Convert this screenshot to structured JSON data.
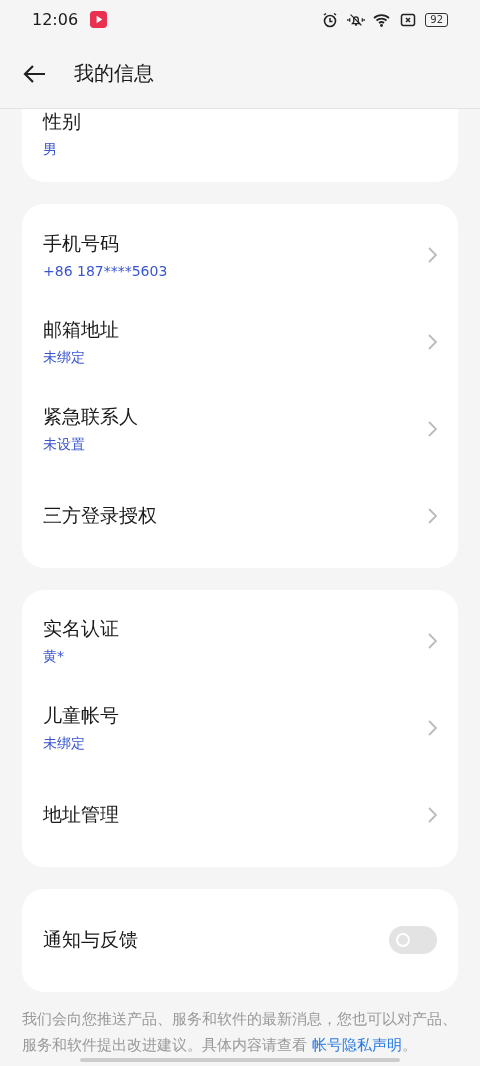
{
  "status_bar": {
    "time": "12:06",
    "battery": "92"
  },
  "header": {
    "title": "我的信息"
  },
  "groups": [
    {
      "items": [
        {
          "kind": "info",
          "label": "性别",
          "value": "男"
        }
      ]
    },
    {
      "items": [
        {
          "kind": "nav",
          "label": "手机号码",
          "value": "+86 187****5603"
        },
        {
          "kind": "nav",
          "label": "邮箱地址",
          "value": "未绑定"
        },
        {
          "kind": "nav",
          "label": "紧急联系人",
          "value": "未设置"
        },
        {
          "kind": "nav",
          "label": "三方登录授权"
        }
      ]
    },
    {
      "items": [
        {
          "kind": "nav",
          "label": "实名认证",
          "value": "黄*"
        },
        {
          "kind": "nav",
          "label": "儿童帐号",
          "value": "未绑定"
        },
        {
          "kind": "nav",
          "label": "地址管理"
        }
      ]
    },
    {
      "items": [
        {
          "kind": "toggle",
          "label": "通知与反馈",
          "on": false
        }
      ]
    }
  ],
  "footer": {
    "text": "我们会向您推送产品、服务和软件的最新消息，您也可以对产品、服务和软件提出改进建议。具体内容请查看 ",
    "link": "帐号隐私声明",
    "end": "。"
  }
}
